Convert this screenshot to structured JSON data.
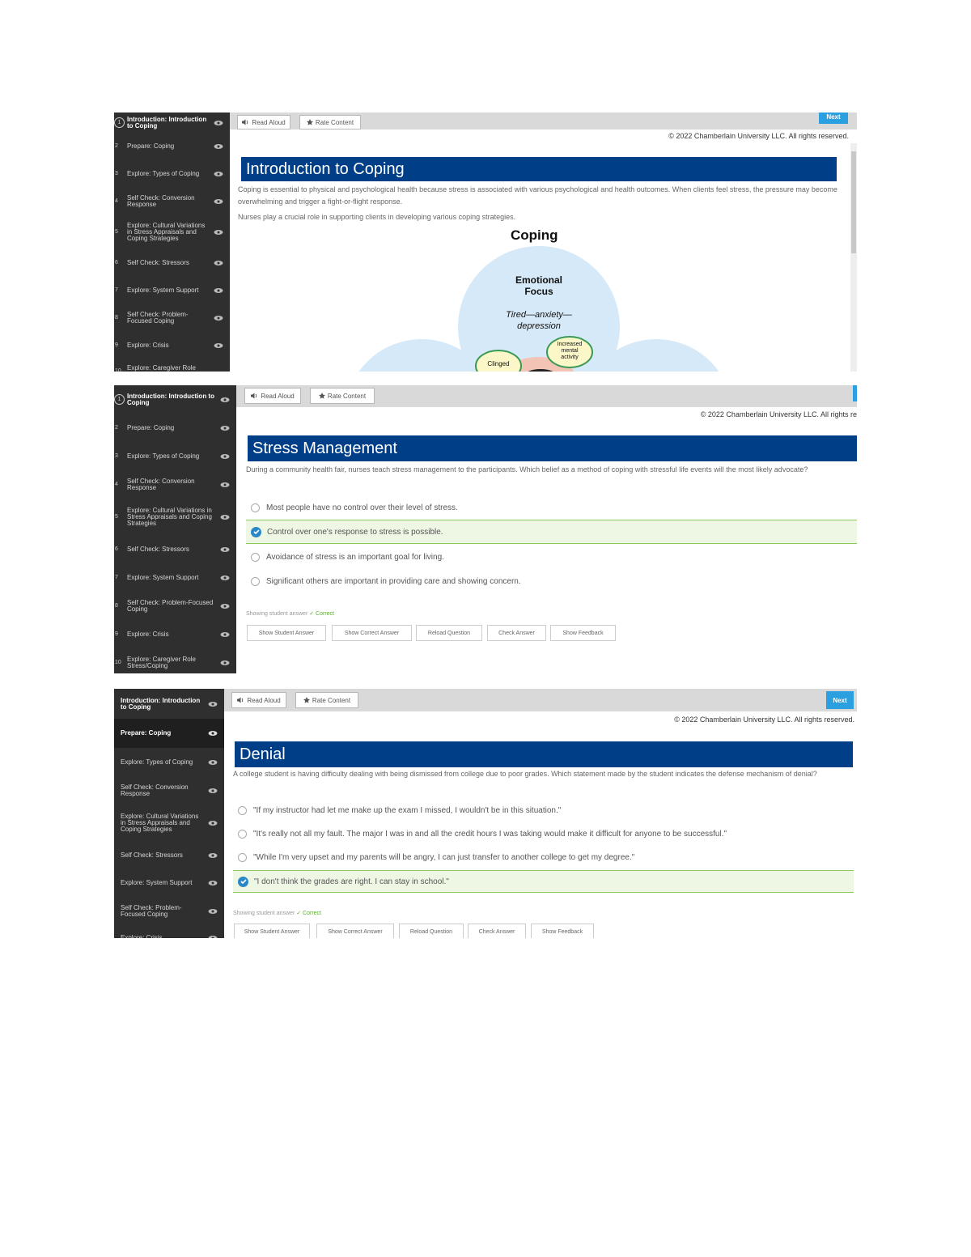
{
  "sidebar_items": [
    "Introduction: Introduction to Coping",
    "Prepare: Coping",
    "Explore: Types of Coping",
    "Self Check: Conversion Response",
    "Explore: Cultural Variations in Stress Appraisals and Coping Strategies",
    "Self Check: Stressors",
    "Explore: System Support",
    "Self Check: Problem-Focused Coping",
    "Explore: Crisis",
    "Explore: Caregiver Role Stress/Coping"
  ],
  "sidebar_numbers": [
    "1",
    "2",
    "3",
    "4",
    "5",
    "6",
    "7",
    "8",
    "9",
    "10"
  ],
  "toolbar": {
    "read_aloud": "Read Aloud",
    "rate_content": "Rate Content",
    "next": "Next"
  },
  "copyright": "© 2022 Chamberlain University LLC. All rights reserved.",
  "copyright_cut": "© 2022 Chamberlain University LLC. All rights re",
  "panel1": {
    "heading": "Introduction to Coping",
    "para1": "Coping is essential to physical and psychological health because stress is associated with various psychological and health outcomes. When clients feel stress, the pressure may become overwhelming and trigger a fight-or-flight response.",
    "para2": "Nurses play a crucial role in supporting clients in developing various coping strategies.",
    "diagram": {
      "title": "Coping",
      "center_title_1": "Emotional",
      "center_title_2": "Focus",
      "center_sub_1": "Tired—anxiety—",
      "center_sub_2": "depression",
      "bubble_right_1": "Increased",
      "bubble_right_2": "mental",
      "bubble_right_3": "activity",
      "bubble_left_1": "Clinged",
      "bubble_left_2": "..."
    }
  },
  "panel2": {
    "heading": "Stress Management",
    "question": "During a community health fair, nurses teach stress management to the participants. Which belief as a method of coping with stressful life events will the most likely advocate?",
    "options": [
      "Most people have no control over their level of stress.",
      "Control over one's response to stress is possible.",
      "Avoidance of stress is an important goal for living.",
      "Significant others are important in providing care and showing concern."
    ],
    "correct_index": 1,
    "status_label": "Showing student answer",
    "status_result": "✓ Correct",
    "buttons": [
      "Show Student Answer",
      "Show Correct Answer",
      "Reload Question",
      "Check Answer",
      "Show Feedback"
    ]
  },
  "panel3": {
    "heading": "Denial",
    "question": "A college student is having difficulty dealing with being dismissed from college due to poor grades. Which statement made by the student indicates the defense mechanism of denial?",
    "options": [
      "\"If my instructor had let me make up the exam I missed, I wouldn't be in this situation.\"",
      "\"It's really not all my fault. The major I was in and all the credit hours I was taking would make it difficult for anyone to be successful.\"",
      "\"While I'm very upset and my parents will be angry, I can just transfer to another college to get my degree.\"",
      "\"I don't think the grades are right. I can stay in school.\""
    ],
    "correct_index": 3,
    "status_label": "Showing student answer",
    "status_result": "✓ Correct",
    "buttons": [
      "Show Student Answer",
      "Show Correct Answer",
      "Reload Question",
      "Check Answer",
      "Show Feedback"
    ]
  },
  "colors": {
    "heading_bg": "#003f87",
    "sidebar_bg": "#2f2f2f",
    "next_bg": "#2aa0e0",
    "correct_bg": "#eef7e4",
    "correct_border": "#8dc85c",
    "check_blue": "#2a88c9"
  },
  "icons": {
    "visibility": "eye-icon",
    "read_aloud": "speaker-icon",
    "rate": "star-icon",
    "selected": "check-circle-icon",
    "unselected": "radio-icon"
  }
}
